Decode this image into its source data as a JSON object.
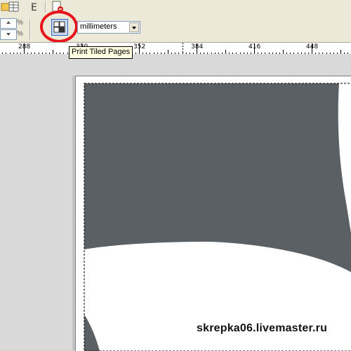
{
  "toolbar": {
    "tiled_pages_icon": "tiled-pages-icon",
    "units": "millimeters"
  },
  "tooltip": {
    "text": "Print Tiled Pages"
  },
  "ruler": {
    "labels": [
      "288",
      "320",
      "352",
      "384",
      "416",
      "448"
    ]
  },
  "watermark": "skrepka06.livemaster.ru",
  "colors": {
    "artwork_fill": "#5a6064",
    "highlight_ring": "#e8131b",
    "tooltip_bg": "#ffffe1"
  }
}
